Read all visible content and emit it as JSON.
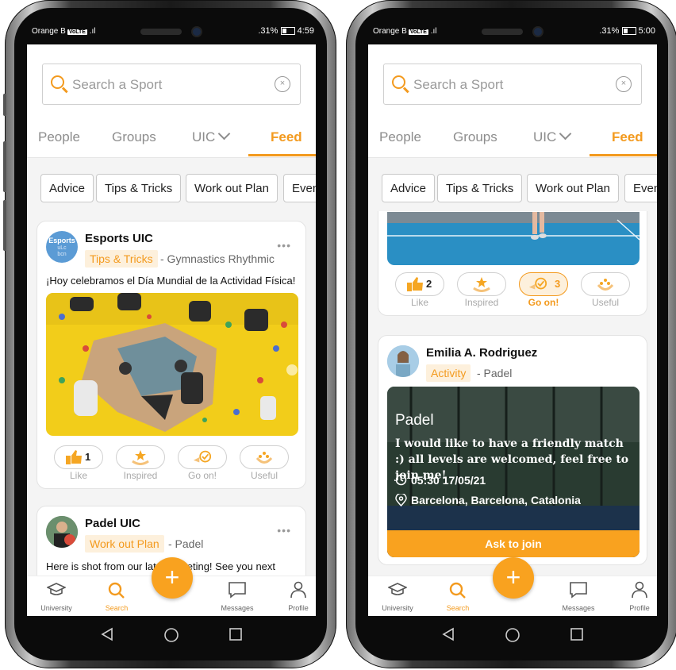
{
  "status_left": {
    "carrier": "Orange B",
    "volte": "VoLTE",
    "signal": ".ıl",
    "battery": ".31%",
    "time": "4:59"
  },
  "status_right": {
    "carrier": "Orange B",
    "volte": "VoLTE",
    "signal": ".ıl",
    "battery": ".31%",
    "time": "5:00"
  },
  "search": {
    "placeholder": "Search a Sport",
    "clear": "×"
  },
  "tabs": [
    "People",
    "Groups",
    "UIC",
    "Feed"
  ],
  "active_tab": "Feed",
  "chips": [
    "Advice",
    "Tips & Tricks",
    "Work out Plan",
    "Events"
  ],
  "post1": {
    "author": "Esports UIC",
    "avatar_text": [
      "Esports",
      "uLc",
      "bcn"
    ],
    "tag": "Tips & Tricks",
    "sport": "- Gymnastics Rhythmic",
    "text": "¡Hoy celebramos el Día Mundial de la Actividad Física!",
    "reactions": {
      "like": "Like",
      "like_count": "1",
      "inspired": "Inspired",
      "goon": "Go on!",
      "useful": "Useful"
    }
  },
  "post2": {
    "author": "Padel UIC",
    "tag": "Work out Plan",
    "sport": "- Padel",
    "text": "Here is shot from our latest meeting! See you next"
  },
  "post3_reactions": {
    "like": "Like",
    "like_count": "2",
    "inspired": "Inspired",
    "goon": "Go on!",
    "goon_count": "3",
    "useful": "Useful"
  },
  "post4": {
    "author": "Emilia A. Rodriguez",
    "tag": "Activity",
    "sport": "- Padel",
    "title": "Padel",
    "description": "I would like to have a friendly match :) all levels are welcomed, feel free to join me!",
    "time": "05:30 17/05/21",
    "location": "Barcelona, Barcelona, Catalonia",
    "join": "Ask to join"
  },
  "bottom_nav": {
    "university": "University",
    "search": "Search",
    "messages": "Messages",
    "profile": "Profile",
    "fab": "+"
  },
  "colors": {
    "accent": "#f39a1e",
    "tag_bg": "#fdf0dc"
  }
}
